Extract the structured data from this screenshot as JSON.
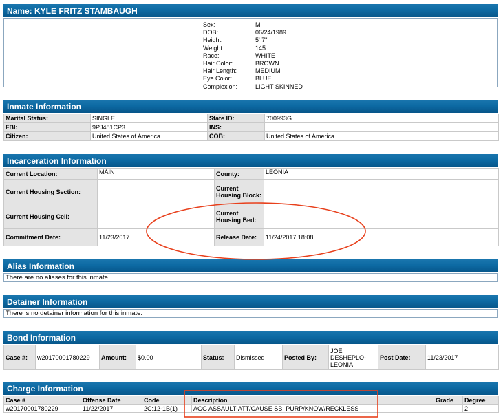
{
  "name_header": "Name: KYLE FRITZ STAMBAUGH",
  "physical": [
    {
      "label": "Sex:",
      "value": "M"
    },
    {
      "label": "DOB:",
      "value": "06/24/1989"
    },
    {
      "label": "Height:",
      "value": "5' 7\""
    },
    {
      "label": "Weight:",
      "value": "145"
    },
    {
      "label": "Race:",
      "value": "WHITE"
    },
    {
      "label": "Hair Color:",
      "value": "BROWN"
    },
    {
      "label": "Hair Length:",
      "value": "MEDIUM"
    },
    {
      "label": "Eye Color:",
      "value": "BLUE"
    },
    {
      "label": "Complexion:",
      "value": "LIGHT SKINNED"
    }
  ],
  "inmate": {
    "title": "Inmate Information",
    "marital_label": "Marital Status:",
    "marital": "SINGLE",
    "state_id_label": "State ID:",
    "state_id": "700993G",
    "fbi_label": "FBI:",
    "fbi": "9PJ481CP3",
    "ins_label": "INS:",
    "ins": "",
    "citizen_label": "Citizen:",
    "citizen": "United States of America",
    "cob_label": "COB:",
    "cob": "United States of America"
  },
  "incarceration": {
    "title": "Incarceration Information",
    "location_label": "Current Location:",
    "location": "MAIN",
    "county_label": "County:",
    "county": "LEONIA",
    "housing_section_label": "Current Housing Section:",
    "housing_section": "",
    "housing_block_label": "Current Housing Block:",
    "housing_block": "",
    "housing_cell_label": "Current Housing Cell:",
    "housing_cell": "",
    "housing_bed_label": "Current Housing Bed:",
    "housing_bed": "",
    "commitment_label": "Commitment Date:",
    "commitment": "11/23/2017",
    "release_label": "Release Date:",
    "release": "11/24/2017 18:08"
  },
  "alias": {
    "title": "Alias Information",
    "note": "There are no aliases for this inmate."
  },
  "detainer": {
    "title": "Detainer Information",
    "note": "There is no detainer information for this inmate."
  },
  "bond": {
    "title": "Bond Information",
    "case_label": "Case #:",
    "case": "w20170001780229",
    "amount_label": "Amount:",
    "amount": "$0.00",
    "status_label": "Status:",
    "status": "Dismissed",
    "posted_by_label": "Posted By:",
    "posted_by": "JOE DESHEPLO-LEONIA",
    "post_date_label": "Post Date:",
    "post_date": "11/23/2017"
  },
  "charge": {
    "title": "Charge Information",
    "columns": [
      "Case #",
      "Offense Date",
      "Code",
      "Description",
      "Grade",
      "Degree"
    ],
    "rows": [
      {
        "case": "w20170001780229",
        "offense_date": "11/22/2017",
        "code": "2C:12-1B(1)",
        "description": "AGG ASSAULT-ATT/CAUSE SBI PURP/KNOW/RECKLESS",
        "grade": "",
        "degree": "2"
      }
    ]
  },
  "annotation_color": "#e8401c"
}
